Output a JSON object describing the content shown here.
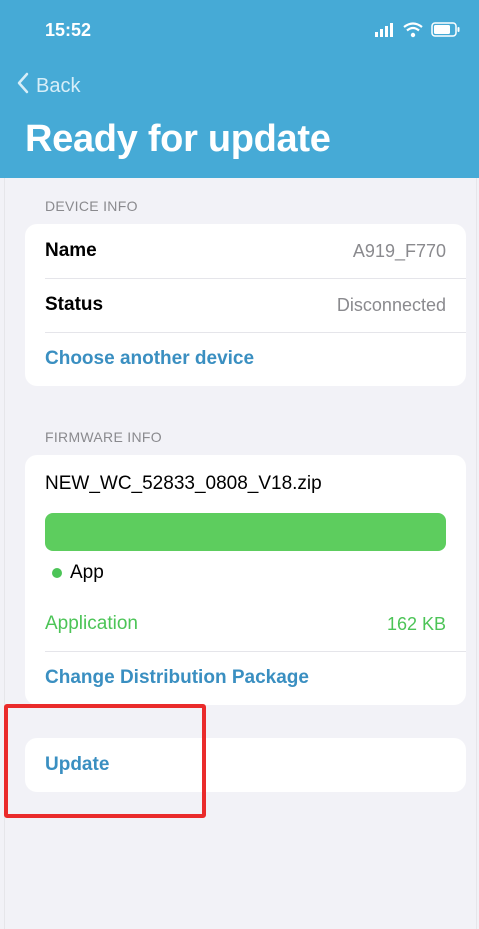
{
  "status_bar": {
    "time": "15:52"
  },
  "nav": {
    "back_label": "Back",
    "title": "Ready for update"
  },
  "device_info": {
    "section_title": "DEVICE INFO",
    "rows": [
      {
        "label": "Name",
        "value": "A919_F770"
      },
      {
        "label": "Status",
        "value": "Disconnected"
      }
    ],
    "choose_label": "Choose another device"
  },
  "firmware_info": {
    "section_title": "FIRMWARE INFO",
    "file_name": "NEW_WC_52833_0808_V18.zip",
    "progress_fraction": 1.0,
    "legend_label": "App",
    "application_label": "Application",
    "application_size": "162 KB",
    "change_label": "Change Distribution Package"
  },
  "actions": {
    "update_label": "Update"
  },
  "colors": {
    "header": "#46aad6",
    "link": "#3a8fc1",
    "green": "#4cc457",
    "highlight": "#ea2b2b"
  }
}
